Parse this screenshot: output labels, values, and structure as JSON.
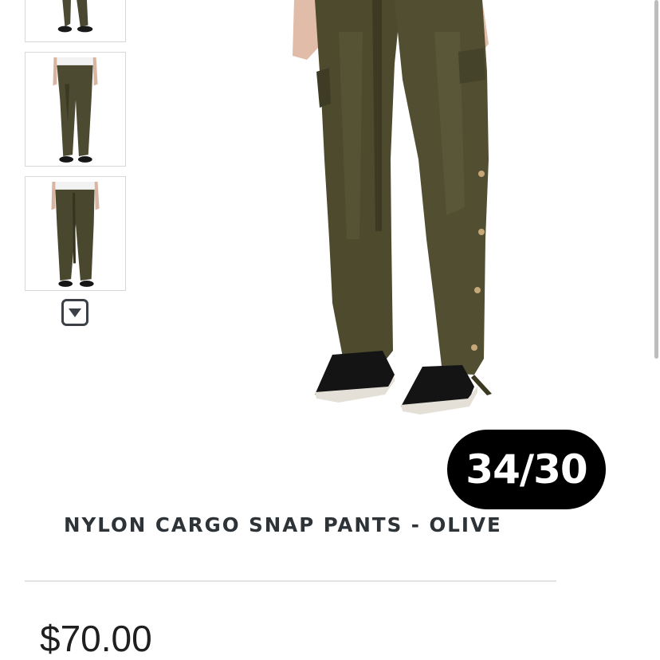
{
  "gallery": {
    "thumbnails": [
      {
        "icon": "pants-thumbnail-back"
      },
      {
        "icon": "pants-thumbnail-front"
      },
      {
        "icon": "pants-thumbnail-front-alt"
      }
    ],
    "scroll_icon": "chevron-down-icon"
  },
  "main_image": {
    "icon": "olive-cargo-pants-model"
  },
  "size_badge": {
    "label": "34/30"
  },
  "product": {
    "title": "NYLON CARGO SNAP PANTS - OLIVE",
    "price": "$70.00"
  },
  "colors": {
    "olive": "#4a4a2c",
    "badge_bg": "#000000",
    "title_text": "#2e3338"
  }
}
